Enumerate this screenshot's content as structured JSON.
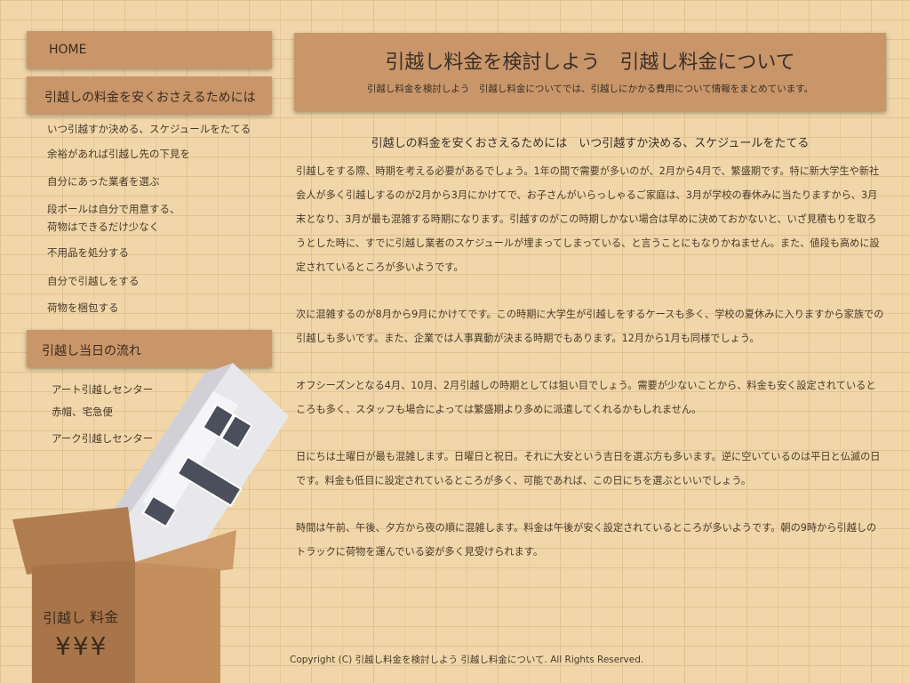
{
  "sidebar": {
    "home": "HOME",
    "section1_title": "引越しの料金を安くおさえるためには",
    "section1_items": [
      "いつ引越すか決める、スケジュールをたてる",
      "余裕があれば引越し先の下見を",
      "自分にあった業者を選ぶ",
      "段ボールは自分で用意する、",
      "荷物はできるだけ少なく",
      "不用品を処分する",
      "自分で引越しをする",
      "荷物を梱包する"
    ],
    "section2_title": "引越し当日の流れ",
    "section2_items": [
      "アート引越しセンター",
      "赤帽、宅急便",
      "アーク引越しセンター"
    ]
  },
  "header": {
    "title": "引越し料金を検討しよう　引越し料金について",
    "subtitle": "引越し料金を検討しよう　引越し料金についてでは、引越しにかかる費用について情報をまとめています。"
  },
  "content": {
    "heading": "引越しの料金を安くおさえるためには　いつ引越すか決める、スケジュールをたてる",
    "paragraphs": [
      "引越しをする際、時期を考える必要があるでしょう。1年の間で需要が多いのが、2月から4月で、繁盛期です。特に新大学生や新社会人が多く引越しするのが2月から3月にかけてで、お子さんがいらっしゃるご家庭は、3月が学校の春休みに当たりますから、3月末となり、3月が最も混雑する時期になります。引越すのがこの時期しかない場合は早めに決めておかないと、いざ見積もりを取ろうとした時に、すでに引越し業者のスケジュールが埋まってしまっている、と言うことにもなりかねません。また、値段も高めに設定されているところが多いようです。",
      "次に混雑するのが8月から9月にかけてです。この時期に大学生が引越しをするケースも多く、学校の夏休みに入りますから家族での引越しも多いです。また、企業では人事異動が決まる時期でもあります。12月から1月も同様でしょう。",
      "オフシーズンとなる4月、10月、2月引越しの時期としては狙い目でしょう。需要が少ないことから、料金も安く設定されているところも多く、スタッフも場合によっては繁盛期より多めに派遣してくれるかもしれません。",
      "日にちは土曜日が最も混雑します。日曜日と祝日。それに大安という吉日を選ぶ方も多います。逆に空いているのは平日と仏滅の日です。料金も低目に設定されているところが多く、可能であれば、この日にちを選ぶといいでしょう。",
      "時間は午前、午後、夕方から夜の順に混雑します。料金は午後が安く設定されているところが多いようです。朝の9時から引越しのトラックに荷物を運んでいる姿が多く見受けられます。"
    ]
  },
  "illustration": {
    "box_label": "引越し 料金",
    "box_yen": "¥¥¥"
  },
  "footer": {
    "copyright": "Copyright (C)  引越し料金を検討しよう  引越し料金について.  All Rights Reserved."
  },
  "colors": {
    "background": "#f0d6a9",
    "panel": "#c9966a",
    "text": "#4a3a2a"
  }
}
